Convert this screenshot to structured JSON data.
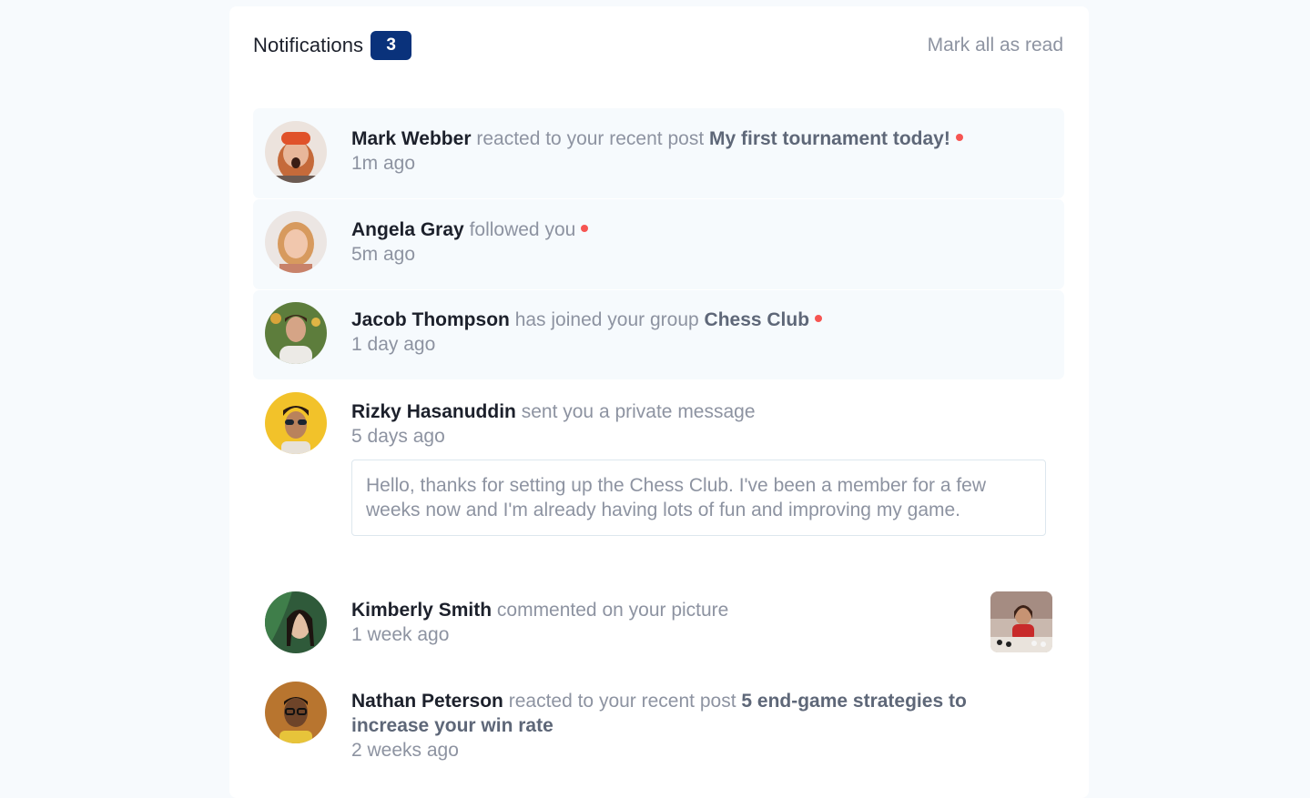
{
  "header": {
    "title": "Notifications",
    "unread_count": "3",
    "mark_all_label": "Mark all as read"
  },
  "notifications": [
    {
      "name": "Mark Webber",
      "action": "reacted to your recent post",
      "target": "My first tournament today!",
      "time": "1m ago",
      "unread": true
    },
    {
      "name": "Angela Gray",
      "action": "followed you",
      "target": "",
      "time": "5m ago",
      "unread": true
    },
    {
      "name": "Jacob Thompson",
      "action": "has joined your group",
      "target": "Chess Club",
      "time": "1 day ago",
      "unread": true
    },
    {
      "name": "Rizky Hasanuddin",
      "action": "sent you a private message",
      "target": "",
      "time": "5 days ago",
      "unread": false,
      "message": "Hello, thanks for setting up the Chess Club. I've been a member for a few weeks now and I'm already having lots of fun and improving my game."
    },
    {
      "name": "Kimberly Smith",
      "action": "commented on your picture",
      "target": "",
      "time": "1 week ago",
      "unread": false
    },
    {
      "name": "Nathan Peterson",
      "action": "reacted to your recent post",
      "target": "5 end-game strategies to increase your win rate",
      "time": "2 weeks ago",
      "unread": false
    }
  ],
  "colors": {
    "badge": "#0a327b",
    "unread_bg": "#f6fafd",
    "dot": "#f65552"
  }
}
